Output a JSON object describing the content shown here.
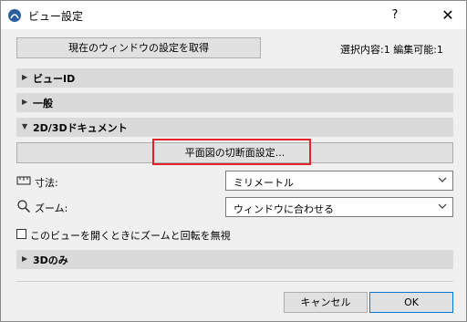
{
  "window": {
    "title": "ビュー設定",
    "help": "?",
    "close": "✕"
  },
  "toolbar": {
    "get_settings_label": "現在のウィンドウの設定を取得",
    "selection_info": "選択内容:1 編集可能:1"
  },
  "sections": {
    "view_id": "ビューID",
    "general": "一般",
    "doc_2d3d": "2D/3Dドキュメント",
    "only_3d": "3Dのみ"
  },
  "cutplane": {
    "label": "平面図の切断面設定..."
  },
  "dimensions": {
    "label": "寸法:",
    "value": "ミリメートル"
  },
  "zoom": {
    "label": "ズーム:",
    "value": "ウィンドウに合わせる"
  },
  "ignore_zoom": {
    "label": "このビューを開くときにズームと回転を無視",
    "checked": false
  },
  "footer": {
    "cancel_label": "キャンセル",
    "ok_label": "OK"
  },
  "colors": {
    "highlight": "#e8202a",
    "ok_border": "#0078d7",
    "section_bg": "#dadada"
  }
}
